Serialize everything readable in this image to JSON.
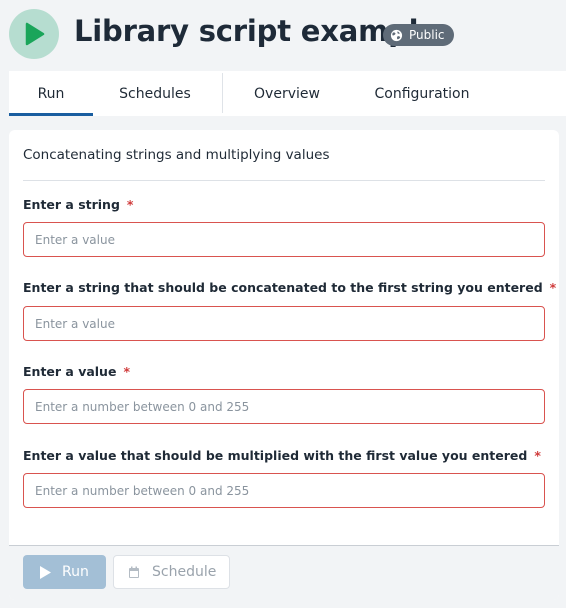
{
  "header": {
    "title": "Library script example",
    "visibility": "Public",
    "icons": {
      "run": "play-icon",
      "visibility": "globe-icon"
    },
    "colors": {
      "run_badge": "#b6ddd0",
      "play": "#1aa55a",
      "pill": "#5f6b78"
    }
  },
  "tabs": [
    {
      "label": "Run",
      "active": true
    },
    {
      "label": "Schedules",
      "active": false
    },
    {
      "label": "Overview",
      "active": false
    },
    {
      "label": "Configuration",
      "active": false
    }
  ],
  "form": {
    "title": "Concatenating strings and multiplying values",
    "required_marker": "*",
    "fields": [
      {
        "label": "Enter a string",
        "placeholder": "Enter a value",
        "value": ""
      },
      {
        "label": "Enter a string that should be concatenated to the first string you entered",
        "placeholder": "Enter a value",
        "value": ""
      },
      {
        "label": "Enter a value",
        "placeholder": "Enter a number between 0 and 255",
        "value": ""
      },
      {
        "label": "Enter a value that should be multiplied with the first value you entered",
        "placeholder": "Enter a number between 0 and 255",
        "value": ""
      }
    ]
  },
  "actions": {
    "run_label": "Run",
    "schedule_label": "Schedule",
    "icons": {
      "run": "play-icon",
      "schedule": "calendar-icon"
    }
  },
  "colors": {
    "accent": "#1a5ea0",
    "error_border": "#d9534f",
    "required": "#d03b3b"
  }
}
